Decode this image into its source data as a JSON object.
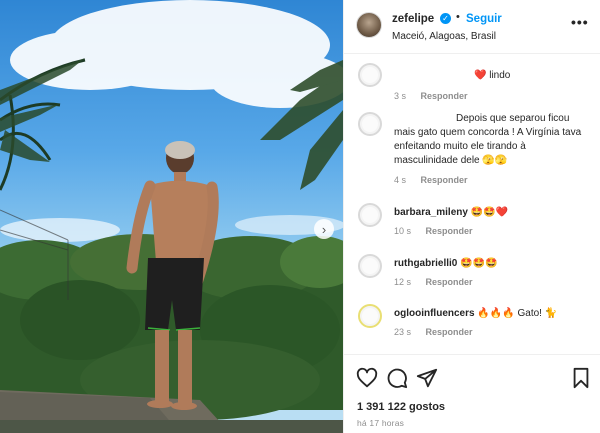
{
  "post": {
    "username": "zefelipe",
    "verified": true,
    "follow_label": "Seguir",
    "location": "Maceió, Alagoas, Brasil",
    "more_label": "•••",
    "next_label": "›"
  },
  "comments": [
    {
      "username": "",
      "text": "❤️ lindo",
      "time": "3 s",
      "reply_label": "Responder"
    },
    {
      "username": "",
      "text": "Depois que separou ficou mais gato quem concorda ! A Virgínia tava enfeitando muito ele tirando à masculinidade dele 🫣🫣",
      "time": "4 s",
      "reply_label": "Responder"
    },
    {
      "username": "barbara_mileny",
      "text": "🤩🤩❤️",
      "time": "10 s",
      "reply_label": "Responder"
    },
    {
      "username": "ruthgabrielli0",
      "text": "🤩🤩🤩",
      "time": "12 s",
      "reply_label": "Responder"
    },
    {
      "username": "oglooinfluencers",
      "text": "🔥🔥🔥 Gato! 🐈",
      "time": "23 s",
      "reply_label": "Responder"
    }
  ],
  "actions": {
    "likes": "1 391 122 gostos",
    "time": "há 17 horas"
  },
  "icons": {
    "like": "heart-icon",
    "comment": "comment-icon",
    "share": "send-icon",
    "save": "bookmark-icon",
    "more": "more-options-icon",
    "verified": "verified-badge-icon"
  },
  "colors": {
    "accent": "#0095f6",
    "text": "#262626",
    "muted": "#8e8e8e",
    "heart": "#ed4956"
  }
}
